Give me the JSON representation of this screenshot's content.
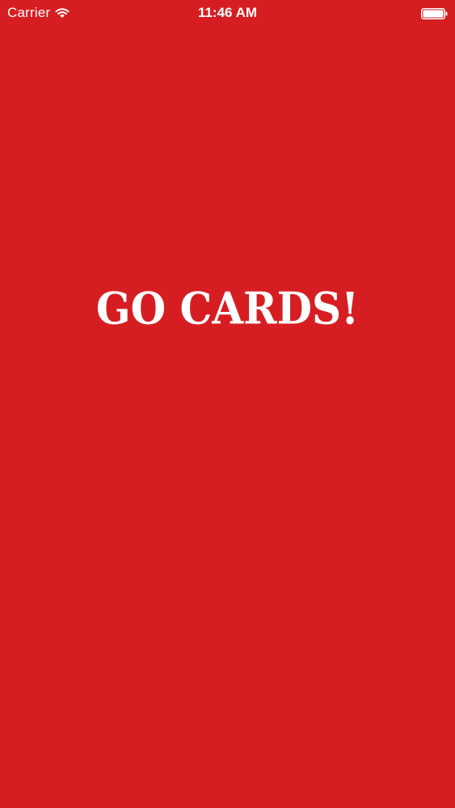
{
  "status_bar": {
    "carrier": "Carrier",
    "time": "11:46 AM",
    "icons": [
      "wifi-icon",
      "battery-icon"
    ]
  },
  "splash": {
    "title": "GO CARDS!"
  },
  "colors": {
    "background": "#d61e22",
    "text": "#ffffff"
  }
}
